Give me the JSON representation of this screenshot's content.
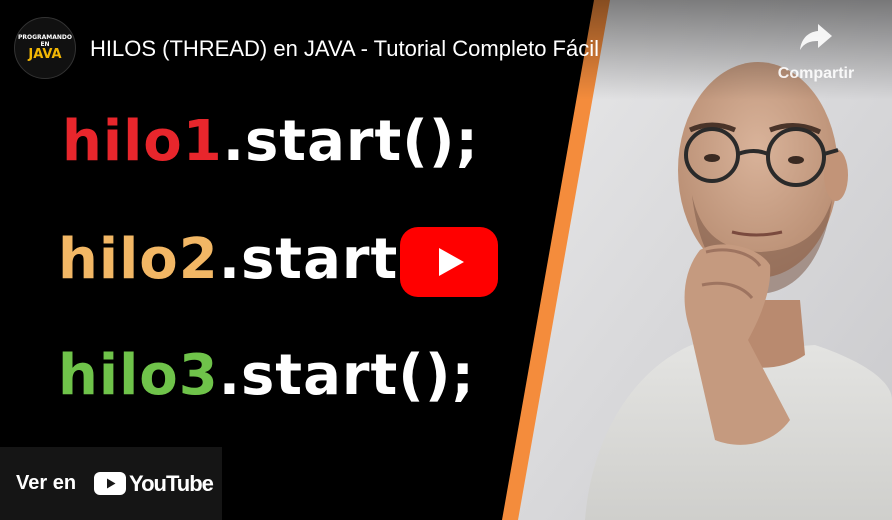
{
  "video": {
    "title": "HILOS (THREAD) en JAVA - Tutorial Completo Fácil"
  },
  "channel": {
    "avatar_line1": "PROGRAMANDO",
    "avatar_line2": "EN",
    "avatar_line3": "JAVA"
  },
  "share": {
    "label": "Compartir",
    "icon": "share-arrow-icon"
  },
  "thumbnail": {
    "lines": [
      {
        "var": "hilo1",
        "rest": ".start();",
        "color": "#e8262c"
      },
      {
        "var": "hilo2",
        "rest": ".start(",
        "color": "#f2b765"
      },
      {
        "var": "hilo3",
        "rest": ".start();",
        "color": "#6fc34a"
      }
    ]
  },
  "play_button": {
    "icon": "play-icon",
    "color": "#ff0000"
  },
  "watch_on": {
    "label": "Ver en",
    "brand": "YouTube",
    "icon": "youtube-logo-icon"
  }
}
